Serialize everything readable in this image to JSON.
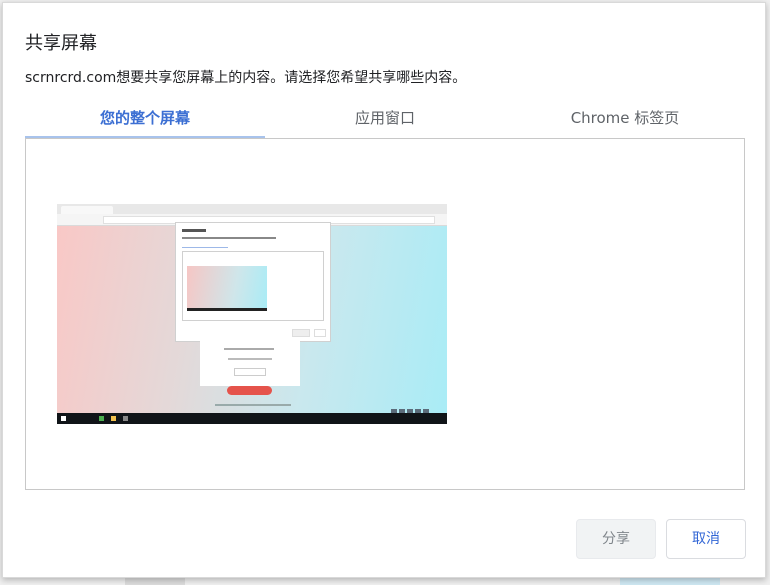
{
  "dialog": {
    "title": "共享屏幕",
    "description": "scrnrcrd.com想要共享您屏幕上的内容。请选择您希望共享哪些内容。"
  },
  "tabs": [
    {
      "label": "您的整个屏幕",
      "active": true
    },
    {
      "label": "应用窗口",
      "active": false
    },
    {
      "label": "Chrome 标签页",
      "active": false
    }
  ],
  "buttons": {
    "share_label": "分享",
    "cancel_label": "取消"
  },
  "colors": {
    "accent": "#3c6fd3",
    "tab_underline": "#a8c3ec",
    "cancel_text": "#3367d6"
  }
}
